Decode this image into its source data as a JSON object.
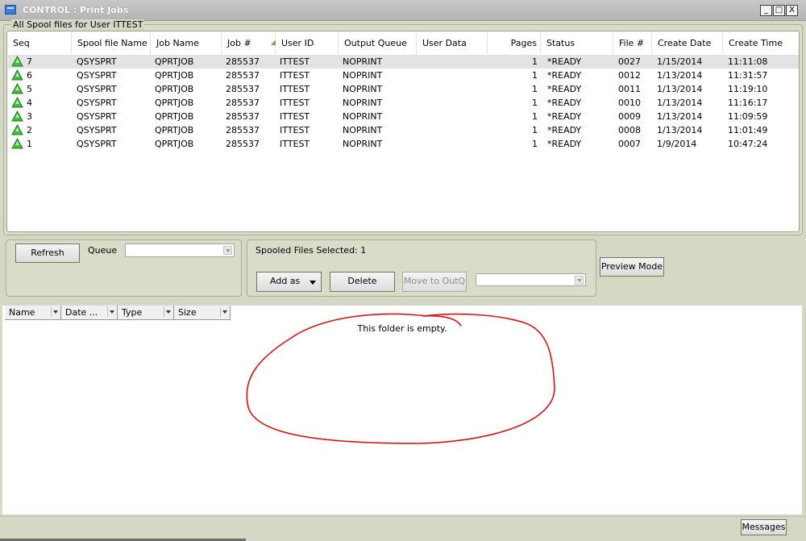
{
  "window": {
    "title": "CONTROL : Print Jobs",
    "controls": {
      "minimize": "_",
      "maximize": "□",
      "close": "X"
    }
  },
  "spool_group": {
    "label": "All Spool files for User ITTEST",
    "columns": [
      "Seq",
      "Spool file Name",
      "Job Name",
      "Job #",
      "User ID",
      "Output Queue",
      "User Data",
      "Pages",
      "Status",
      "File #",
      "Create Date",
      "Create Time"
    ],
    "rows": [
      {
        "seq": "7",
        "spool_file": "QSYSPRT",
        "job_name": "QPRTJOB",
        "job_num": "285537",
        "user_id": "ITTEST",
        "output_queue": "NOPRINT",
        "user_data": "",
        "pages": "1",
        "status": "*READY",
        "file_num": "0027",
        "create_date": "1/15/2014",
        "create_time": "11:11:08"
      },
      {
        "seq": "6",
        "spool_file": "QSYSPRT",
        "job_name": "QPRTJOB",
        "job_num": "285537",
        "user_id": "ITTEST",
        "output_queue": "NOPRINT",
        "user_data": "",
        "pages": "1",
        "status": "*READY",
        "file_num": "0012",
        "create_date": "1/13/2014",
        "create_time": "11:31:57"
      },
      {
        "seq": "5",
        "spool_file": "QSYSPRT",
        "job_name": "QPRTJOB",
        "job_num": "285537",
        "user_id": "ITTEST",
        "output_queue": "NOPRINT",
        "user_data": "",
        "pages": "1",
        "status": "*READY",
        "file_num": "0011",
        "create_date": "1/13/2014",
        "create_time": "11:19:10"
      },
      {
        "seq": "4",
        "spool_file": "QSYSPRT",
        "job_name": "QPRTJOB",
        "job_num": "285537",
        "user_id": "ITTEST",
        "output_queue": "NOPRINT",
        "user_data": "",
        "pages": "1",
        "status": "*READY",
        "file_num": "0010",
        "create_date": "1/13/2014",
        "create_time": "11:16:17"
      },
      {
        "seq": "3",
        "spool_file": "QSYSPRT",
        "job_name": "QPRTJOB",
        "job_num": "285537",
        "user_id": "ITTEST",
        "output_queue": "NOPRINT",
        "user_data": "",
        "pages": "1",
        "status": "*READY",
        "file_num": "0009",
        "create_date": "1/13/2014",
        "create_time": "11:09:59"
      },
      {
        "seq": "2",
        "spool_file": "QSYSPRT",
        "job_name": "QPRTJOB",
        "job_num": "285537",
        "user_id": "ITTEST",
        "output_queue": "NOPRINT",
        "user_data": "",
        "pages": "1",
        "status": "*READY",
        "file_num": "0008",
        "create_date": "1/13/2014",
        "create_time": "11:01:49"
      },
      {
        "seq": "1",
        "spool_file": "QSYSPRT",
        "job_name": "QPRTJOB",
        "job_num": "285537",
        "user_id": "ITTEST",
        "output_queue": "NOPRINT",
        "user_data": "",
        "pages": "1",
        "status": "*READY",
        "file_num": "0007",
        "create_date": "1/9/2014",
        "create_time": "10:47:24"
      }
    ],
    "selected_row": 0,
    "sorted_column": "Job #"
  },
  "controls_left": {
    "refresh_label": "Refresh",
    "queue_label": "Queue",
    "queue_value": ""
  },
  "controls_mid": {
    "selected_text": "Spooled Files Selected: 1",
    "add_as_label": "Add as",
    "delete_label": "Delete",
    "move_label": "Move to OutQ",
    "outq_value": ""
  },
  "preview_label": "Preview Mode",
  "folder_view": {
    "columns": [
      "Name",
      "Date ...",
      "Type",
      "Size"
    ],
    "empty_message": "This folder is empty."
  },
  "status": {
    "messages_label": "Messages"
  },
  "colors": {
    "ready_icon": "#3fbf3f",
    "annotation": "#e01010",
    "selected_row": "#e3e3e3"
  }
}
